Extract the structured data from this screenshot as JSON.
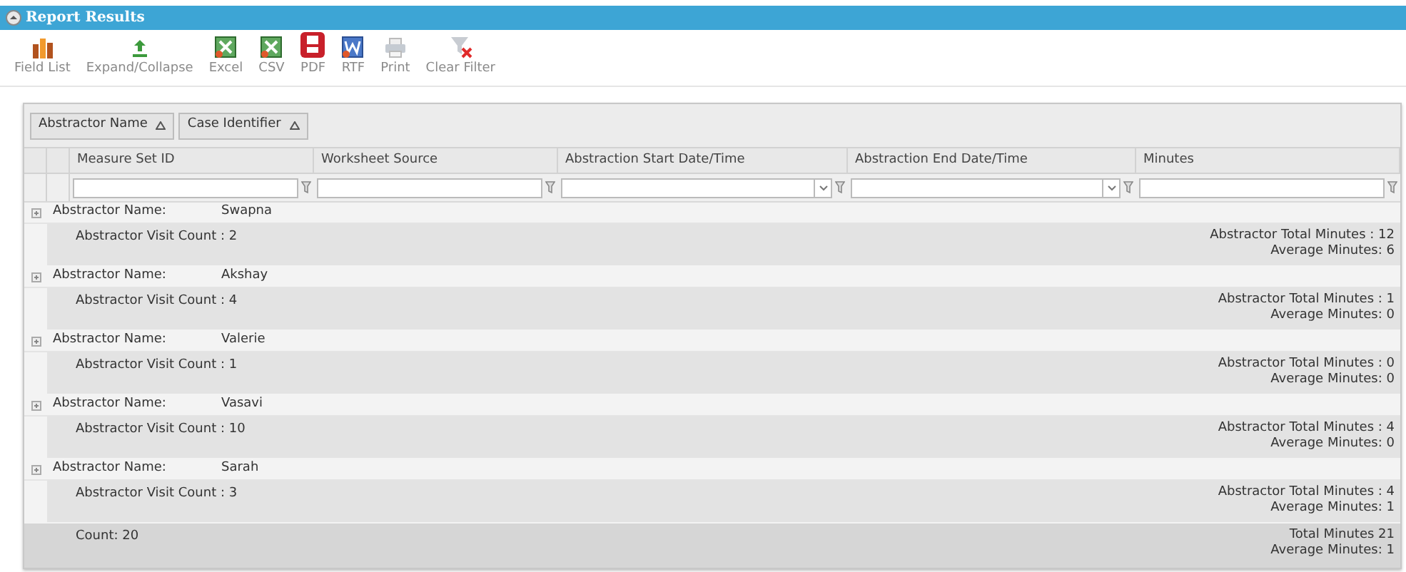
{
  "window": {
    "title": "Report Results"
  },
  "toolbar": [
    {
      "label": "Field List",
      "kind": "fieldlist"
    },
    {
      "label": "Expand/Collapse",
      "kind": "expand"
    },
    {
      "label": "Excel",
      "kind": "excel"
    },
    {
      "label": "CSV",
      "kind": "csv"
    },
    {
      "label": "PDF",
      "kind": "pdf"
    },
    {
      "label": "RTF",
      "kind": "rtf"
    },
    {
      "label": "Print",
      "kind": "print"
    },
    {
      "label": "Clear Filter",
      "kind": "clearfilter"
    }
  ],
  "group_by": [
    {
      "label": "Abstractor Name"
    },
    {
      "label": "Case Identifier"
    }
  ],
  "columns": [
    {
      "label": "Measure Set ID",
      "kind": "text"
    },
    {
      "label": "Worksheet Source",
      "kind": "text"
    },
    {
      "label": "Abstraction Start Date/Time",
      "kind": "date"
    },
    {
      "label": "Abstraction End Date/Time",
      "kind": "date"
    },
    {
      "label": "Minutes",
      "kind": "text"
    }
  ],
  "groups": [
    {
      "label": "Abstractor Name:",
      "name": "Swapna",
      "visit_count": "Abstractor Visit Count : 2",
      "total_minutes": "Abstractor Total Minutes : 12",
      "average_minutes": "Average Minutes: 6"
    },
    {
      "label": "Abstractor Name:",
      "name": "Akshay",
      "visit_count": "Abstractor Visit Count : 4",
      "total_minutes": "Abstractor Total Minutes : 1",
      "average_minutes": "Average Minutes: 0"
    },
    {
      "label": "Abstractor Name:",
      "name": "Valerie",
      "visit_count": "Abstractor Visit Count : 1",
      "total_minutes": "Abstractor Total Minutes : 0",
      "average_minutes": "Average Minutes: 0"
    },
    {
      "label": "Abstractor Name:",
      "name": "Vasavi",
      "visit_count": "Abstractor Visit Count : 10",
      "total_minutes": "Abstractor Total Minutes : 4",
      "average_minutes": "Average Minutes: 0"
    },
    {
      "label": "Abstractor Name:",
      "name": "Sarah",
      "visit_count": "Abstractor Visit Count : 3",
      "total_minutes": "Abstractor Total Minutes : 4",
      "average_minutes": "Average Minutes: 1"
    }
  ],
  "footer": {
    "count": "Count: 20",
    "total_minutes": "Total Minutes 21",
    "average_minutes": "Average Minutes: 1"
  }
}
